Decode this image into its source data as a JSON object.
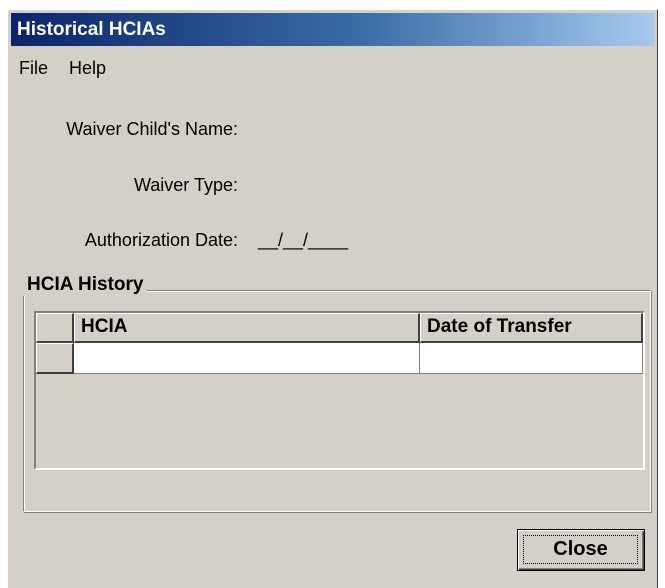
{
  "window": {
    "title": "Historical HCIAs"
  },
  "menu": {
    "items": [
      {
        "label": "File"
      },
      {
        "label": "Help"
      }
    ]
  },
  "fields": {
    "child_name_label": "Waiver Child's Name:",
    "child_name_value": "",
    "waiver_type_label": "Waiver Type:",
    "waiver_type_value": "",
    "authorization_date_label": "Authorization Date:",
    "authorization_date_value": "__/__/____"
  },
  "history": {
    "group_title": "HCIA History",
    "columns": [
      "HCIA",
      "Date of Transfer"
    ],
    "rows": [
      {
        "hcia": "",
        "date_of_transfer": ""
      }
    ]
  },
  "buttons": {
    "close_label": "Close"
  },
  "colors": {
    "window_background": "#d4d0c8",
    "title_gradient_start": "#0a246a",
    "title_gradient_end": "#a6caf0",
    "title_text": "#ffffff"
  }
}
